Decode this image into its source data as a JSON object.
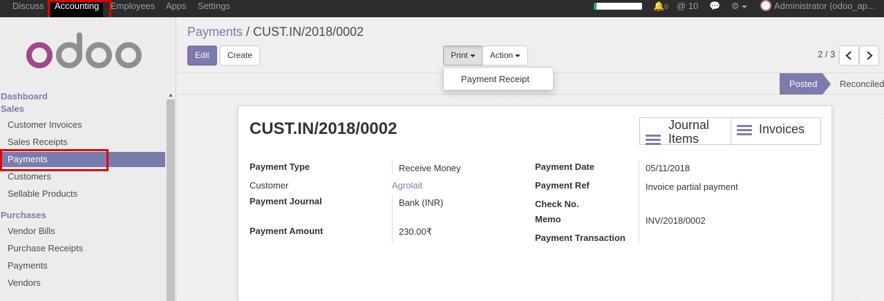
{
  "topbar": {
    "menu": [
      "Discuss",
      "Accounting",
      "Employees",
      "Apps",
      "Settings"
    ],
    "active": "Accounting",
    "notifications": "0",
    "mentions": "10",
    "user": "Administrator (odoo_ap..."
  },
  "sidebar": {
    "dashboard": "Dashboard",
    "sales_heading": "Sales",
    "sales_items": [
      "Customer Invoices",
      "Sales Receipts",
      "Payments",
      "Customers",
      "Sellable Products"
    ],
    "purchases_heading": "Purchases",
    "purchase_items": [
      "Vendor Bills",
      "Purchase Receipts",
      "Payments",
      "Vendors"
    ],
    "active_item": "Payments"
  },
  "breadcrumb": {
    "parent": "Payments",
    "separator": "/",
    "current": "CUST.IN/2018/0002"
  },
  "buttons": {
    "edit": "Edit",
    "create": "Create",
    "print": "Print",
    "action": "Action"
  },
  "print_menu": {
    "items": [
      "Payment Receipt"
    ]
  },
  "pager": {
    "value": "2 / 3"
  },
  "status": {
    "stages": [
      "Posted",
      "Reconciled"
    ],
    "current": "Posted"
  },
  "record": {
    "title": "CUST.IN/2018/0002",
    "smart_buttons": {
      "journal_items_line1": "Journal",
      "journal_items_line2": "Items",
      "invoices": "Invoices"
    },
    "left_fields": [
      {
        "label": "Payment Type",
        "value": "Receive Money"
      },
      {
        "label": "Customer",
        "value": "Agrolait"
      },
      {
        "label": "Payment Journal",
        "value": "Bank (INR)"
      },
      {
        "label": "Payment Amount",
        "value": "230.00₹"
      }
    ],
    "right_fields": [
      {
        "label": "Payment Date",
        "value": "05/11/2018"
      },
      {
        "label": "Payment Ref",
        "value": "Invoice partial payment"
      },
      {
        "label": "Check No.",
        "value": ""
      },
      {
        "label": "Memo",
        "value": "INV/2018/0002"
      },
      {
        "label": "Payment Transaction",
        "value": ""
      }
    ]
  },
  "colors": {
    "brand": "#7c7bad",
    "topbar": "#2c2c2c",
    "highlight": "#e00000"
  }
}
